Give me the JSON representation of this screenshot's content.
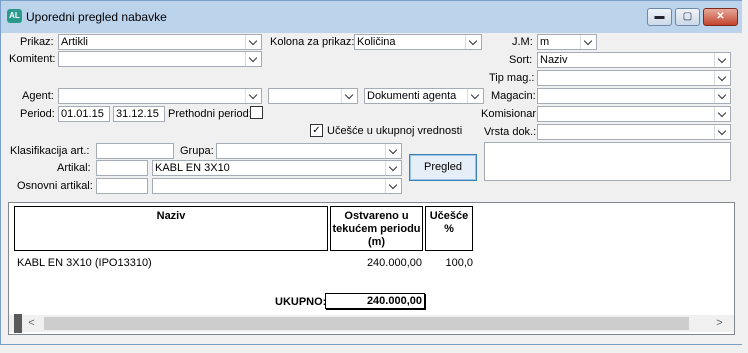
{
  "window": {
    "title": "Uporedni pregled nabavke",
    "icon_text": "AL",
    "minimize_icon": "minimize-icon",
    "maximize_icon": "maximize-icon",
    "close_icon": "close-icon"
  },
  "form": {
    "prikaz": {
      "label": "Prikaz:",
      "value": "Artikli"
    },
    "kolona_za_prikaz": {
      "label": "Kolona za prikaz:",
      "value": "Količina"
    },
    "jm": {
      "label": "J.M:",
      "value": "m"
    },
    "komitent": {
      "label": "Komitent:",
      "value": ""
    },
    "sort": {
      "label": "Sort:",
      "value": "Naziv"
    },
    "tip_mag": {
      "label": "Tip mag.:",
      "value": ""
    },
    "agent": {
      "label": "Agent:",
      "value": "",
      "value2": "",
      "value3": "Dokumenti agenta"
    },
    "magacin": {
      "label": "Magacin:",
      "value": ""
    },
    "period": {
      "label": "Period:",
      "from": "01.01.15",
      "to": "31.12.15"
    },
    "prethodni_period": {
      "label": "Prethodni period:",
      "checked": false
    },
    "komisionar": {
      "label": "Komisionar:",
      "value": ""
    },
    "ucesce": {
      "label": "Učešće u ukupnoj vrednosti",
      "checked": true
    },
    "vrsta_dok": {
      "label": "Vrsta dok.:",
      "value": ""
    },
    "klasifikacija": {
      "label": "Klasifikacija art.:",
      "value": ""
    },
    "grupa": {
      "label": "Grupa:",
      "value": ""
    },
    "artikal": {
      "label": "Artikal:",
      "code": "",
      "value": "KABL EN 3X10"
    },
    "osnovni_artikal": {
      "label": "Osnovni artikal:",
      "code": "",
      "value": ""
    },
    "pregled_button": "Pregled"
  },
  "grid": {
    "columns": [
      "Naziv",
      "Ostvareno u tekućem periodu (m)",
      "Učešće %"
    ],
    "rows": [
      {
        "naziv": "KABL EN 3X10 (IPO13310)",
        "ostvareno": "240.000,00",
        "ucesce": "100,0"
      }
    ],
    "total_label": "UKUPNO:",
    "total_value": "240.000,00"
  }
}
